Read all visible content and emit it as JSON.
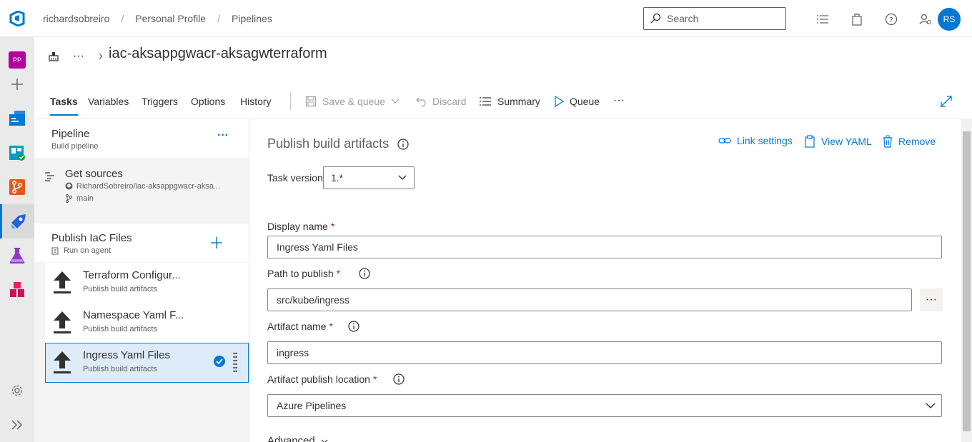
{
  "header": {
    "breadcrumbs": [
      "richardsobreiro",
      "Personal Profile",
      "Pipelines"
    ],
    "search_placeholder": "Search",
    "avatar_initials": "RS"
  },
  "nav": {
    "project_badge": "PP"
  },
  "title": {
    "more": "···",
    "chevron": "›",
    "text": "iac-aksappgwacr-aksagwterraform"
  },
  "toolbar": {
    "tabs": [
      "Tasks",
      "Variables",
      "Triggers",
      "Options",
      "History"
    ],
    "save_queue": "Save & queue",
    "discard": "Discard",
    "summary": "Summary",
    "queue": "Queue",
    "more": "···"
  },
  "tasks_pane": {
    "pipeline_title": "Pipeline",
    "pipeline_sub": "Build pipeline",
    "pipeline_more": "···",
    "sources_title": "Get sources",
    "sources_repo": "RichardSobreiro/iac-aksappgwacr-aksa...",
    "sources_branch": "main",
    "job_title": "Publish IaC Files",
    "job_sub": "Run on agent",
    "tasks": [
      {
        "name": "Terraform Configur...",
        "sub": "Publish build artifacts"
      },
      {
        "name": "Namespace Yaml F...",
        "sub": "Publish build artifacts"
      },
      {
        "name": "Ingress Yaml Files",
        "sub": "Publish build artifacts"
      }
    ]
  },
  "form": {
    "title": "Publish build artifacts",
    "link_settings": "Link settings",
    "view_yaml": "View YAML",
    "remove": "Remove",
    "task_version_label": "Task version",
    "task_version_value": "1.*",
    "display_name_label": "Display name",
    "display_name_value": "Ingress Yaml Files",
    "path_label": "Path to publish",
    "path_value": "src/kube/ingress",
    "path_browse": "···",
    "artifact_name_label": "Artifact name",
    "artifact_name_value": "ingress",
    "location_label": "Artifact publish location",
    "location_value": "Azure Pipelines",
    "required_mark": "*",
    "advanced_label": "Advanced"
  },
  "colors": {
    "accent": "#0078d4",
    "selected_bg": "#deecf9",
    "required": "#a4262c"
  }
}
